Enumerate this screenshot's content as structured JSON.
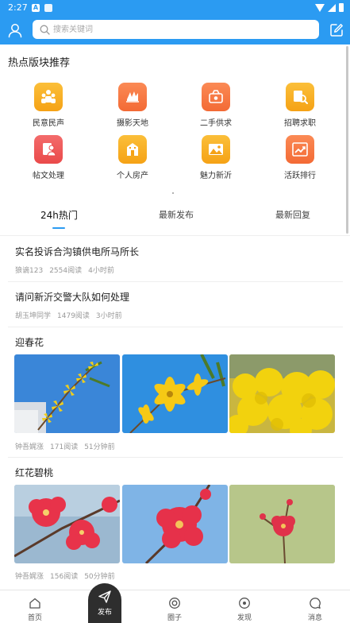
{
  "status_bar": {
    "time": "2:27",
    "app_badge": "A"
  },
  "header": {
    "search_placeholder": "搜索关键词"
  },
  "hot_section": {
    "title": "热点版块推荐",
    "items": [
      {
        "label": "民意民声",
        "icon": "people-icon",
        "color": "#f5a216"
      },
      {
        "label": "摄影天地",
        "icon": "camera-hands-icon",
        "color": "#f36a35"
      },
      {
        "label": "二手供求",
        "icon": "basket-icon",
        "color": "#f36a35"
      },
      {
        "label": "招聘求职",
        "icon": "job-search-icon",
        "color": "#f5a216"
      },
      {
        "label": "帖文处理",
        "icon": "document-person-icon",
        "color": "#ea4a4a"
      },
      {
        "label": "个人房产",
        "icon": "building-icon",
        "color": "#f5a216"
      },
      {
        "label": "魅力新沂",
        "icon": "landscape-icon",
        "color": "#f5a216"
      },
      {
        "label": "活跃排行",
        "icon": "trend-chart-icon",
        "color": "#f36a35"
      }
    ]
  },
  "tabs": [
    {
      "label": "24h热门",
      "active": true
    },
    {
      "label": "最新发布",
      "active": false
    },
    {
      "label": "最新回复",
      "active": false
    }
  ],
  "posts": [
    {
      "title": "实名投诉合沟镇供电所马所长",
      "author": "狼谪123",
      "reads": "2554阅读",
      "time": "4小时前"
    },
    {
      "title": "请问新沂交警大队如何处理",
      "author": "胡玉坤同学",
      "reads": "1479阅读",
      "time": "3小时前"
    },
    {
      "title": "迎春花",
      "author": "钟吾娓涨",
      "reads": "171阅读",
      "time": "51分钟前"
    },
    {
      "title": "红花碧桃",
      "author": "钟吾娓涨",
      "reads": "156阅读",
      "time": "50分钟前"
    }
  ],
  "bottom_nav": {
    "home": "首页",
    "publish": "发布",
    "circle": "圈子",
    "discover": "发现",
    "messages": "消息"
  }
}
